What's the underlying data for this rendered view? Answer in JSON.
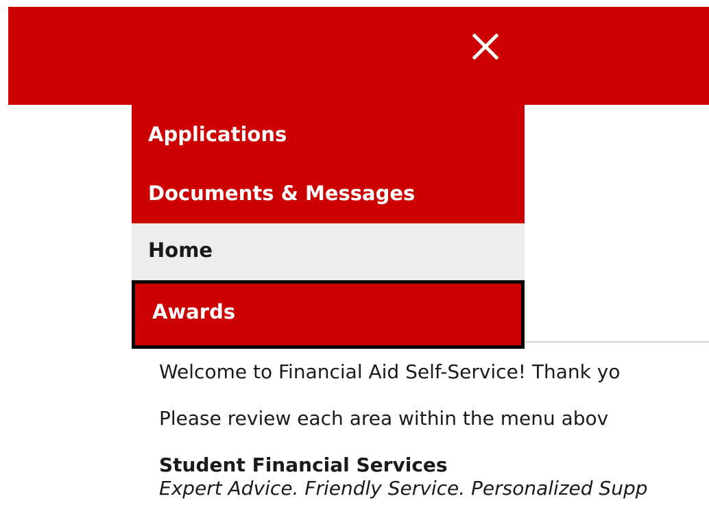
{
  "header": {
    "bar_color": "#cc0000",
    "close_icon": "close-icon",
    "close_label": "Close menu"
  },
  "nav": {
    "items": [
      {
        "label": "Applications",
        "state": "default"
      },
      {
        "label": "Documents & Messages",
        "state": "default"
      },
      {
        "label": "Home",
        "state": "active"
      },
      {
        "label": "Awards",
        "state": "focused"
      }
    ]
  },
  "content": {
    "welcome": "Welcome to Financial Aid Self-Service! Thank yo",
    "review": "Please review each area within the menu abov",
    "sfs_title": "Student Financial Services",
    "sfs_tagline": "Expert Advice. Friendly Service. Personalized Supp"
  },
  "colors": {
    "brand_red": "#cc0000",
    "home_bg": "#ececec",
    "focus_border": "#000000"
  }
}
